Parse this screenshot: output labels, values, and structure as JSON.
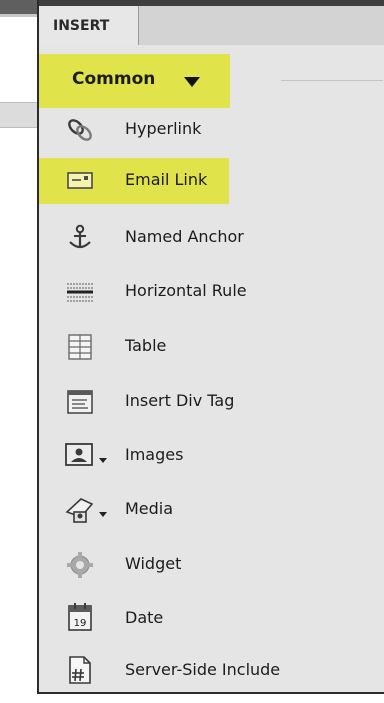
{
  "panel": {
    "tab_label": "INSERT",
    "category_label": "Common"
  },
  "items": [
    {
      "label": "Hyperlink",
      "icon": "hyperlink-icon"
    },
    {
      "label": "Email Link",
      "icon": "email-link-icon"
    },
    {
      "label": "Named Anchor",
      "icon": "named-anchor-icon"
    },
    {
      "label": "Horizontal Rule",
      "icon": "horizontal-rule-icon"
    },
    {
      "label": "Table",
      "icon": "table-icon"
    },
    {
      "label": "Insert Div Tag",
      "icon": "insert-div-tag-icon"
    },
    {
      "label": "Images",
      "icon": "images-icon"
    },
    {
      "label": "Media",
      "icon": "media-icon"
    },
    {
      "label": "Widget",
      "icon": "widget-icon"
    },
    {
      "label": "Date",
      "icon": "date-icon"
    },
    {
      "label": "Server-Side Include",
      "icon": "server-side-include-icon"
    }
  ],
  "colors": {
    "highlight": "#e1e34a",
    "panel_bg": "#e5e5e5",
    "tab_bar": "#3e3e3e"
  },
  "date_icon_day": "19"
}
